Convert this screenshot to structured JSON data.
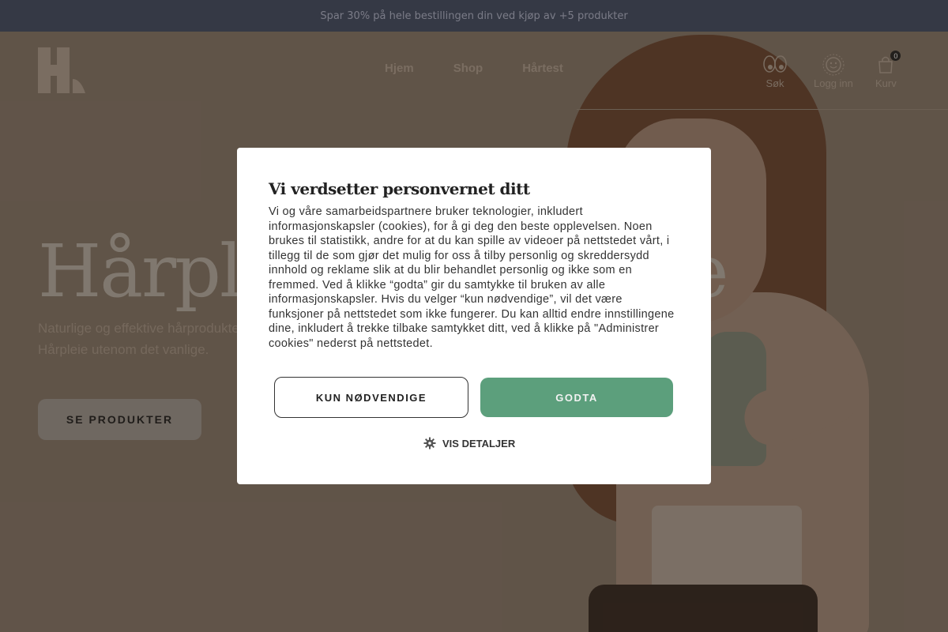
{
  "announcement": {
    "text": "Spar 30% på hele bestillingen din ved kjøp av +5 produkter"
  },
  "nav": {
    "items": [
      "Hjem",
      "Shop",
      "Hårtest"
    ]
  },
  "header_icons": {
    "search": "Søk",
    "login": "Logg inn",
    "cart": "Kurv",
    "cart_count": "0"
  },
  "hero": {
    "title_start": "Hårple",
    "title_end": "e",
    "subtitle": "Naturlige og effektive hårprodukter. Hårpleie utenom det vanlige.",
    "button": "SE PRODUKTER"
  },
  "cookie_modal": {
    "title": "Vi verdsetter personvernet ditt",
    "body": "Vi og våre samarbeidspartnere bruker teknologier, inkludert informasjonskapsler (cookies), for å gi deg den beste opplevelsen. Noen brukes til statistikk, andre for at du kan spille av videoer på nettstedet vårt, i tillegg til de som gjør det mulig for oss å tilby personlig og skreddersydd innhold og reklame slik at du blir behandlet personlig og ikke som en fremmed. Ved å klikke “godta” gir du samtykke til bruken av alle informasjonskapsler. Hvis du velger “kun nødvendige”, vil det være funksjoner på nettstedet som ikke fungerer. Du kan alltid endre innstillingene dine, inkludert å trekke tilbake samtykket ditt, ved å klikke på \"Administrer cookies\" nederst på nettstedet.",
    "btn_necessary": "KUN NØDVENDIGE",
    "btn_accept": "GODTA",
    "details": "VIS DETALJER"
  },
  "colors": {
    "accept": "#5c9f7c",
    "announcement_bg": "#3b4459"
  },
  "icons": [
    "logo-icon",
    "eyes-icon",
    "sun-face-icon",
    "bag-icon",
    "gear-icon"
  ]
}
